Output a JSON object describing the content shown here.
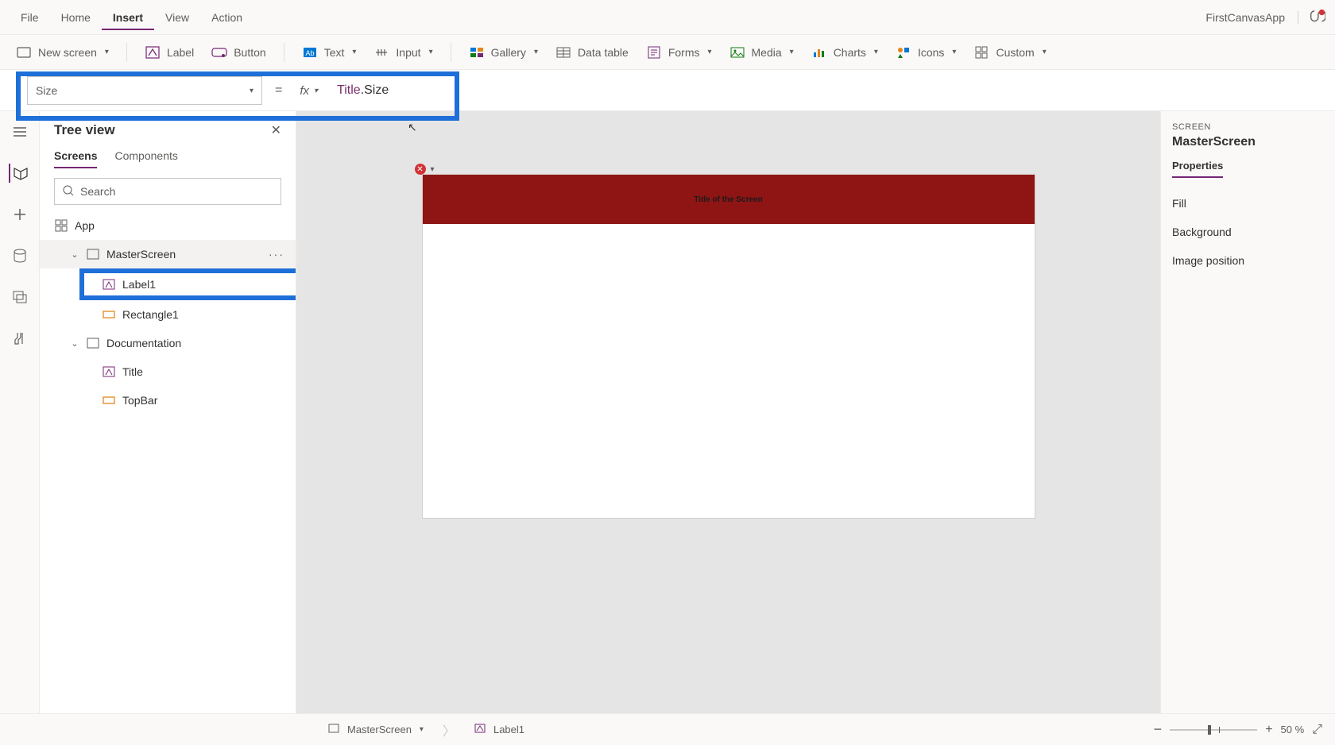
{
  "menu": {
    "file": "File",
    "home": "Home",
    "insert": "Insert",
    "view": "View",
    "action": "Action"
  },
  "app_name": "FirstCanvasApp",
  "ribbon": {
    "new_screen": "New screen",
    "label": "Label",
    "button": "Button",
    "text": "Text",
    "input": "Input",
    "gallery": "Gallery",
    "data_table": "Data table",
    "forms": "Forms",
    "media": "Media",
    "charts": "Charts",
    "icons": "Icons",
    "custom": "Custom"
  },
  "formula": {
    "property": "Size",
    "fx": "fx",
    "expr_obj": "Title",
    "expr_prop": ".Size"
  },
  "tree": {
    "title": "Tree view",
    "tabs": {
      "screens": "Screens",
      "components": "Components"
    },
    "search_placeholder": "Search",
    "nodes": {
      "app": "App",
      "master": "MasterScreen",
      "label1": "Label1",
      "rect1": "Rectangle1",
      "doc": "Documentation",
      "title": "Title",
      "topbar": "TopBar"
    }
  },
  "canvas": {
    "title_text": "Title of the Screen"
  },
  "props": {
    "screen_label": "SCREEN",
    "screen_name": "MasterScreen",
    "tab": "Properties",
    "rows": {
      "fill": "Fill",
      "bg": "Background",
      "imgpos": "Image position"
    }
  },
  "status": {
    "screen": "MasterScreen",
    "control": "Label1",
    "zoom": "50",
    "zoom_unit": "%"
  }
}
